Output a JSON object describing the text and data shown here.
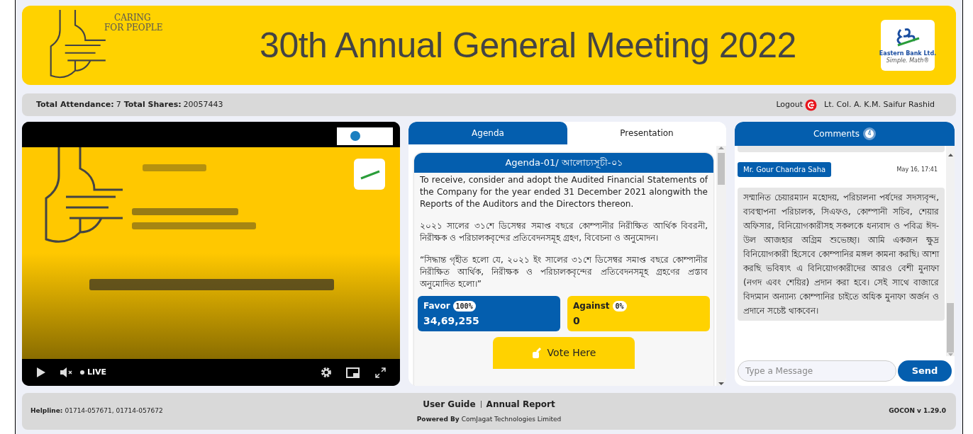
{
  "header": {
    "tagline_1": "CARING",
    "tagline_2": "FOR PEOPLE",
    "title": "30th Annual General Meeting 2022",
    "logo_name": "Eastern Bank Ltd.",
    "logo_slogan": "Simple. Math®"
  },
  "info_bar": {
    "attendance_label": "Total Attendance:",
    "attendance": "7",
    "shares_label": "Total Shares:",
    "shares": "20057443",
    "logout": "Logout",
    "user": "Lt. Col. A. K.M. Saifur Rashid"
  },
  "video": {
    "live": "LIVE"
  },
  "tabs": [
    {
      "label": "Agenda",
      "selected": true
    },
    {
      "label": "Presentation",
      "selected": false
    }
  ],
  "agenda": {
    "title": "Agenda-01/ আলোচ্যসূচী-০১",
    "paragraphs": [
      "To receive, consider and adopt the Audited Financial Statements of the Company for the year ended 31 December 2021 alongwith the Reports of the Auditors and the Directors thereon.",
      "২০২১ সালের ৩১শে ডিসেম্বর সমাপ্ত বছরে কোম্পানীর নিরীক্ষিত আর্থিক বিবরনী, নিরীক্ষক ও পরিচালকবৃন্দের প্রতিবেদনসমূহ গ্রহণ, বিবেচনা ও অনুমোদন।",
      "“সিদ্ধান্ত গৃহীত হলো যে, ২০২১ ইং সালের ৩১শে ডিসেম্বর সমাপ্ত বছরে কোম্পানীর নিরীক্ষিত আর্থিক, নিরীক্ষক ও পরিচালকবৃন্দের প্রতিবেদনসমূহ গ্রহণের প্রস্তাব অনুমোদিত হলো।”"
    ],
    "votes": [
      {
        "kind": "favor",
        "label": "Favor",
        "percent": "100%",
        "count": "34,69,255"
      },
      {
        "kind": "against",
        "label": "Against",
        "percent": "0%",
        "count": "0"
      }
    ],
    "vote_button": "Vote Here"
  },
  "comments": {
    "title": "Comments",
    "count": "4",
    "messages": [
      {
        "kind": "clipped"
      },
      {
        "kind": "full",
        "author": "Mr. Gour Chandra Saha",
        "time": "May 16, 17:41",
        "text": "সম্মানিত চেয়ারম্যান মহোদয়, পরিচালনা পর্ষদের সদস্যবৃন্দ, ব্যবস্থাপনা পরিচালক, সিএফও, কোম্পানী সচিব, শেয়ার অফিসার, বিনিয়োগকারীসহ সকলকে ধন্যবাদ ও পবিত্র ঈদ-উল আজহার অগ্রিম শুভেচ্ছা। আমি একজন ক্ষুদ্র বিনিয়োগকারী হিসেবে কোম্পানির মঙ্গল কামনা করছি। আশা করছি ভবিষ্যৎ এ বিনিয়োগকারীদের আরও বেশী মুনাফা (নগদ এবং শেয়ির) প্রদান করা হবে। সেই সাথে বাজারে বিদ্যমান অন্যান্য কোম্পানির চাইতে অধিক মুনাফা অর্জন ও প্রদানে সচেষ্ট থাকবেন।"
      }
    ],
    "input_placeholder": "Type a Message",
    "send": "Send"
  },
  "footer": {
    "helpline_label": "Helpline:",
    "helpline": "01714-057671, 01714-057672",
    "links": [
      "User Guide",
      "Annual Report"
    ],
    "powered_label": "Powered By",
    "powered": "ComJagat Technologies Limited",
    "version": "GOCON v 1.29.0"
  }
}
